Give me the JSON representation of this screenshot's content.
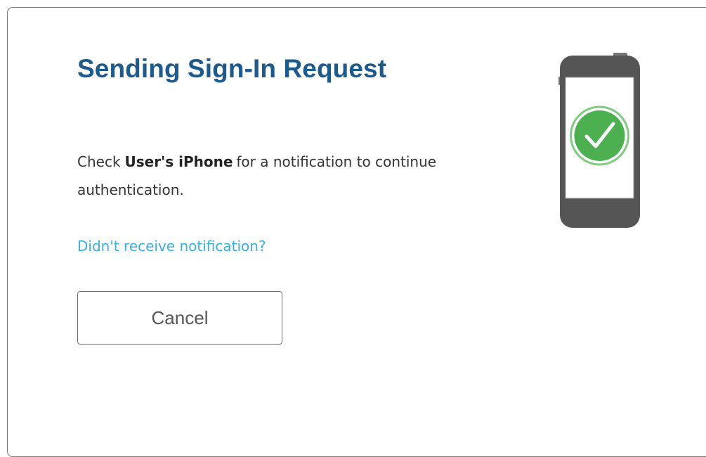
{
  "dialog": {
    "title": "Sending Sign-In Request",
    "message_prefix": "Check",
    "device_name": "User's iPhone",
    "message_suffix": "for a notification to continue authentication.",
    "resend_link": "Didn't receive notification?",
    "cancel_label": "Cancel"
  },
  "illustration": {
    "icon": "phone-checkmark-icon",
    "check_color": "#4caf50",
    "phone_color": "#555555"
  }
}
